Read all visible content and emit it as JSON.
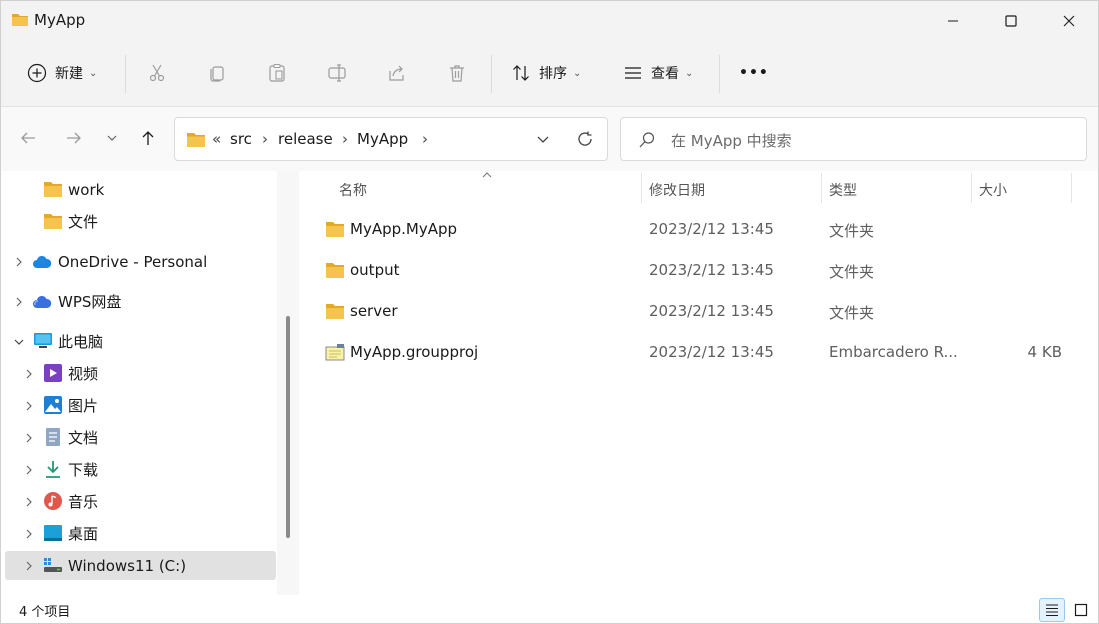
{
  "window": {
    "title": "MyApp",
    "minimize_icon": "minimize-icon",
    "maximize_icon": "maximize-icon",
    "close_icon": "close-icon"
  },
  "toolbar": {
    "new_label": "新建",
    "sort_label": "排序",
    "view_label": "查看",
    "more_label": "•••"
  },
  "address": {
    "overflow": "«",
    "crumbs": [
      "src",
      "release",
      "MyApp"
    ],
    "separator": "›"
  },
  "search": {
    "placeholder": "在 MyApp 中搜索"
  },
  "sidebar": {
    "items": [
      {
        "label": "work",
        "icon": "folder-icon"
      },
      {
        "label": "文件",
        "icon": "folder-icon"
      },
      {
        "label": "OneDrive - Personal",
        "icon": "onedrive-cloud-icon"
      },
      {
        "label": "WPS网盘",
        "icon": "wps-cloud-icon"
      },
      {
        "label": "此电脑",
        "icon": "computer-icon"
      },
      {
        "label": "视频",
        "icon": "video-icon"
      },
      {
        "label": "图片",
        "icon": "pictures-icon"
      },
      {
        "label": "文档",
        "icon": "documents-icon"
      },
      {
        "label": "下载",
        "icon": "download-icon"
      },
      {
        "label": "音乐",
        "icon": "music-icon"
      },
      {
        "label": "桌面",
        "icon": "desktop-icon"
      },
      {
        "label": "Windows11 (C:)",
        "icon": "drive-icon"
      }
    ]
  },
  "columns": {
    "name": "名称",
    "date": "修改日期",
    "type": "类型",
    "size": "大小"
  },
  "files": [
    {
      "name": "MyApp.MyApp",
      "date": "2023/2/12 13:45",
      "type": "文件夹",
      "size": "",
      "icon": "folder-icon"
    },
    {
      "name": "output",
      "date": "2023/2/12 13:45",
      "type": "文件夹",
      "size": "",
      "icon": "folder-icon"
    },
    {
      "name": "server",
      "date": "2023/2/12 13:45",
      "type": "文件夹",
      "size": "",
      "icon": "folder-icon"
    },
    {
      "name": "MyApp.groupproj",
      "date": "2023/2/12 13:45",
      "type": "Embarcadero R...",
      "size": "4 KB",
      "icon": "groupproj-file-icon"
    }
  ],
  "status": {
    "count": "4 个项目"
  },
  "colors": {
    "folder": "#f4c44e",
    "folder_dark": "#e3a928",
    "accent": "#0067c0",
    "selected_bg": "#e1e1e1"
  }
}
